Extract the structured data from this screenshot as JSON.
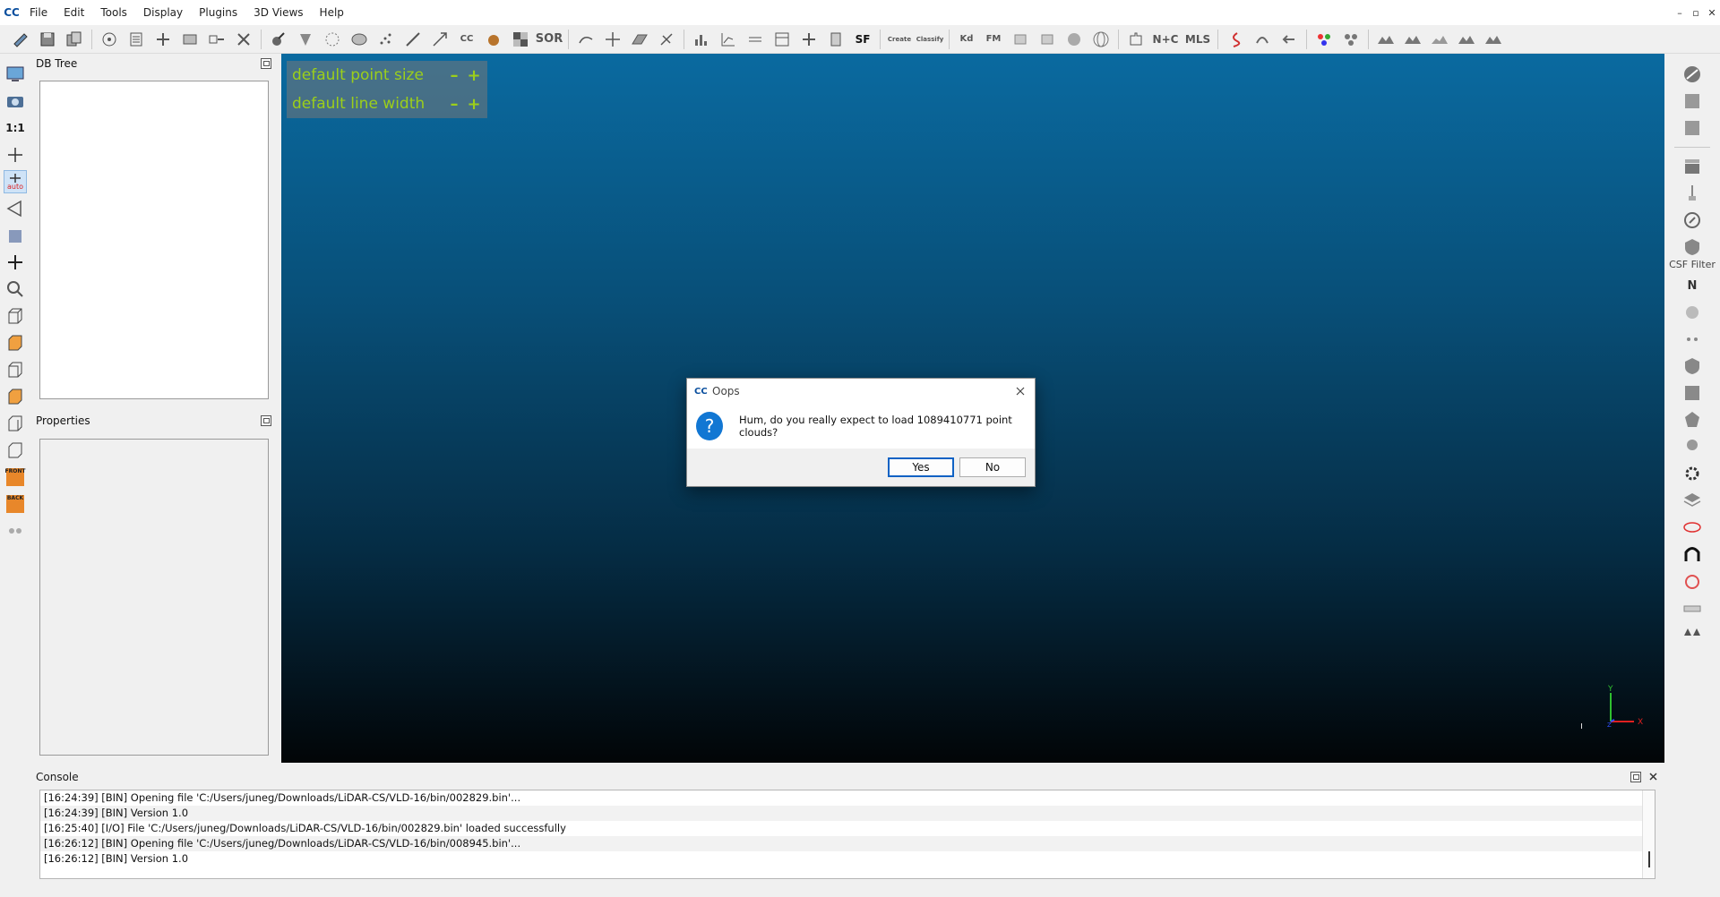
{
  "app": {
    "menu": [
      "File",
      "Edit",
      "Tools",
      "Display",
      "Plugins",
      "3D Views",
      "Help"
    ],
    "logo_text": "CC"
  },
  "toolbar": {
    "sor_label": "SOR",
    "cc_label": "CC",
    "sf_label": "SF",
    "canupo_create": "Create",
    "canupo_classify": "Classify",
    "kd_label": "Kd",
    "fm_label": "FM",
    "nc_label": "N+C",
    "mls_label": "MLS"
  },
  "left_toolbar": {
    "scale_label": "1:1",
    "auto_label": "auto",
    "front_label": "FRONT",
    "back_label": "BACK"
  },
  "db_tree": {
    "title": "DB Tree"
  },
  "properties": {
    "title": "Properties"
  },
  "view3d": {
    "hud": {
      "point_size_label": "default point size",
      "line_width_label": "default line width",
      "minus": "–",
      "plus": "+"
    },
    "axes": {
      "x": "X",
      "y": "Y",
      "z": "Z"
    }
  },
  "right_toolbar": {
    "csf_label": "CSF Filter",
    "n_label": "N"
  },
  "console": {
    "title": "Console",
    "lines": [
      "[16:24:39] [BIN] Opening file 'C:/Users/juneg/Downloads/LiDAR-CS/VLD-16/bin/002829.bin'...",
      "[16:24:39] [BIN] Version 1.0",
      "[16:25:40] [I/O] File 'C:/Users/juneg/Downloads/LiDAR-CS/VLD-16/bin/002829.bin' loaded successfully",
      "[16:26:12] [BIN] Opening file 'C:/Users/juneg/Downloads/LiDAR-CS/VLD-16/bin/008945.bin'...",
      "[16:26:12] [BIN] Version 1.0"
    ]
  },
  "dialog": {
    "title": "Oops",
    "message": "Hum, do you really expect to load 1089410771 point clouds?",
    "yes_label": "Yes",
    "no_label": "No",
    "question_glyph": "?"
  },
  "colors": {
    "accent": "#1277d3",
    "hud_text": "#9ccf1a",
    "view_top": "#0a6aa0",
    "view_bottom": "#020507"
  }
}
